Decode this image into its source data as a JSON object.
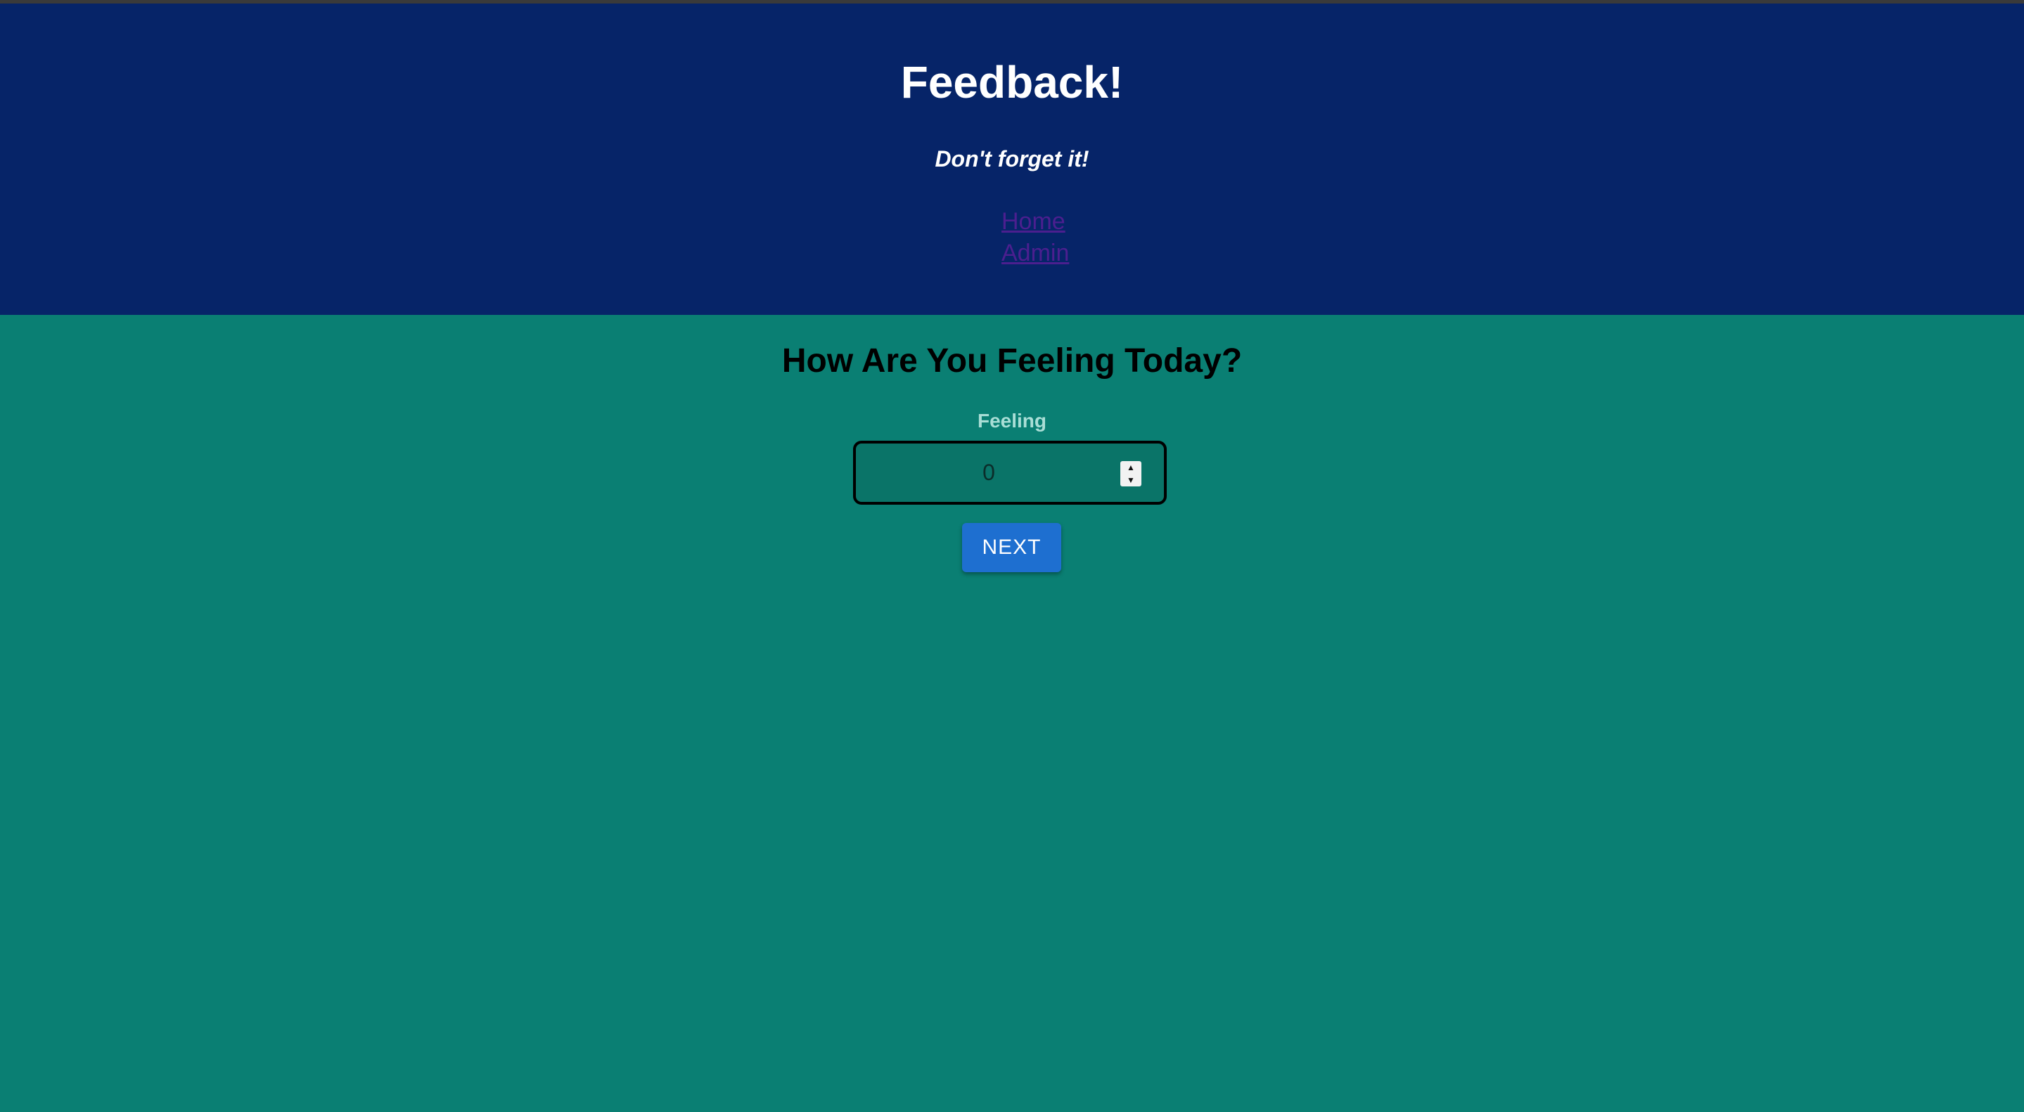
{
  "header": {
    "title": "Feedback!",
    "subtitle": "Don't forget it!",
    "nav": [
      {
        "label": "Home"
      },
      {
        "label": "Admin"
      }
    ]
  },
  "main": {
    "title": "How Are You Feeling Today?",
    "field_label": "Feeling",
    "feeling_value": "0",
    "next_label": "NEXT"
  },
  "colors": {
    "header_bg": "#062468",
    "page_bg": "#0a7f73",
    "button_bg": "#1e6fd0"
  }
}
